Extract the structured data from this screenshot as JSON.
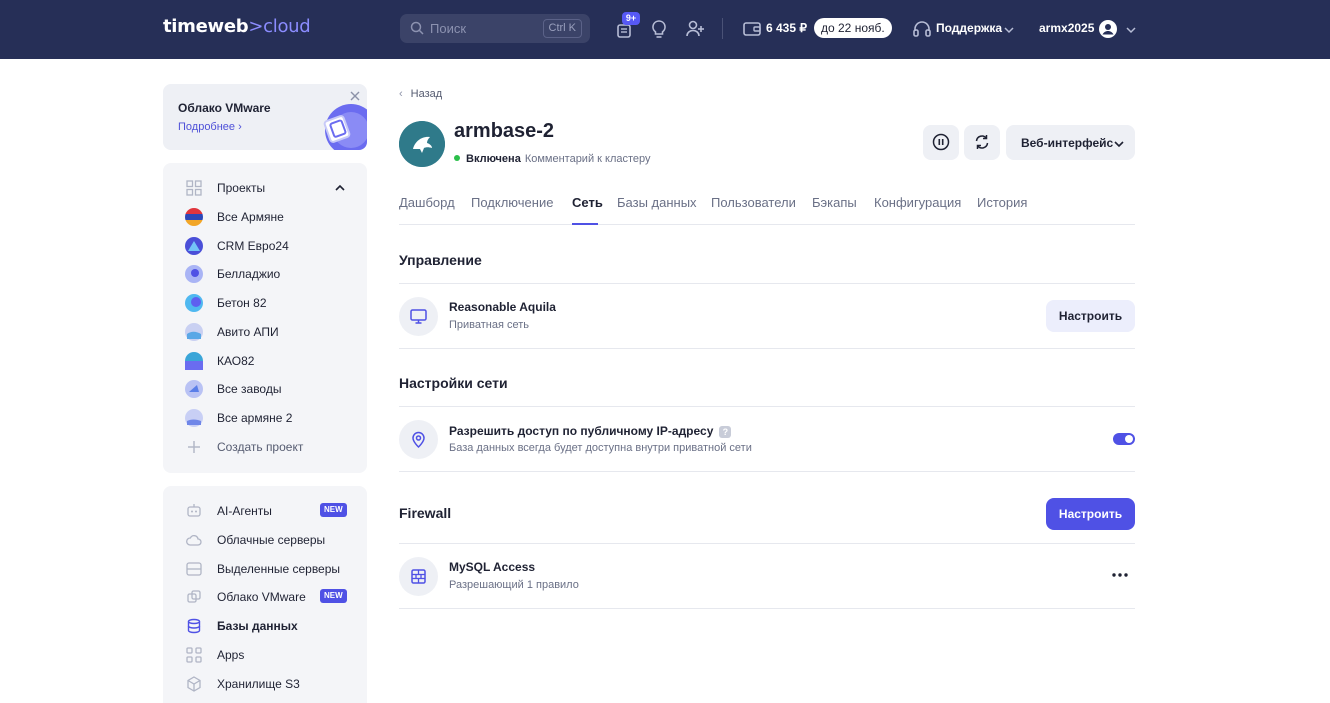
{
  "header": {
    "logo_main": "timeweb",
    "logo_accent": ">cloud",
    "search_placeholder": "Поиск",
    "search_shortcut": "Ctrl K",
    "notifications_badge": "9+",
    "balance": "6 435 ₽",
    "due_date": "до 22 нояб.",
    "support_label": "Поддержка",
    "username": "armx2025",
    "accent_color": "#4f51e5",
    "bg_color": "#262f57"
  },
  "promo": {
    "title": "Облако VMware",
    "link": "Подробнее"
  },
  "projects": {
    "header": "Проекты",
    "items": [
      {
        "label": "Все Армяне",
        "icon": "flag-armenia-icon"
      },
      {
        "label": "CRM Евро24",
        "icon": "project-avatar-icon"
      },
      {
        "label": "Белладжио",
        "icon": "project-avatar-icon"
      },
      {
        "label": "Бетон 82",
        "icon": "project-avatar-icon"
      },
      {
        "label": "Авито АПИ",
        "icon": "project-avatar-icon"
      },
      {
        "label": "КАО82",
        "icon": "project-avatar-icon"
      },
      {
        "label": "Все заводы",
        "icon": "project-avatar-icon"
      },
      {
        "label": "Все армяне 2",
        "icon": "project-avatar-icon"
      }
    ],
    "create_label": "Создать проект"
  },
  "nav": {
    "items": [
      {
        "label": "AI-Агенты",
        "badge": "NEW",
        "icon": "robot-icon"
      },
      {
        "label": "Облачные серверы",
        "icon": "cloud-icon"
      },
      {
        "label": "Выделенные серверы",
        "icon": "server-icon"
      },
      {
        "label": "Облако VMware",
        "badge": "NEW",
        "icon": "vmware-icon"
      },
      {
        "label": "Базы данных",
        "icon": "database-icon"
      },
      {
        "label": "Apps",
        "icon": "apps-grid-icon"
      },
      {
        "label": "Хранилище S3",
        "icon": "storage-box-icon"
      }
    ]
  },
  "main": {
    "back_label": "Назад",
    "title": "armbase-2",
    "status": "Включена",
    "comment": "Комментарий к кластеру",
    "web_interface_label": "Веб-интерфейс",
    "tabs": [
      "Дашборд",
      "Подключение",
      "Сеть",
      "Базы данных",
      "Пользователи",
      "Бэкапы",
      "Конфигурация",
      "История"
    ],
    "active_tab": "Сеть",
    "management": {
      "title": "Управление",
      "network_name": "Reasonable Aquila",
      "network_type": "Приватная сеть",
      "configure_label": "Настроить"
    },
    "network_settings": {
      "title": "Настройки сети",
      "public_ip_title": "Разрешить доступ по публичному IP-адресу",
      "public_ip_help": "?",
      "public_ip_desc": "База данных всегда будет доступна внутри приватной сети",
      "public_ip_enabled": true
    },
    "firewall": {
      "title": "Firewall",
      "configure_label": "Настроить",
      "rule_name": "MySQL Access",
      "rule_desc": "Разрешающий 1 правило"
    }
  }
}
